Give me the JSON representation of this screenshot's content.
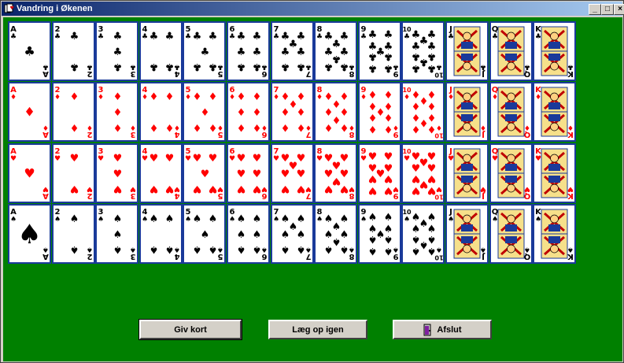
{
  "window": {
    "title": "Vandring i Økenen",
    "controls": {
      "minimize": "_",
      "maximize": "□",
      "close": "×"
    }
  },
  "colors": {
    "felt": "#008000",
    "titlebar": "#0a246a",
    "card_border": "#1a3a9a",
    "red": "#ff0000",
    "black": "#000000"
  },
  "board": {
    "rows": [
      {
        "suit": "clubs",
        "symbol": "♣",
        "color": "black",
        "ranks": [
          "A",
          "2",
          "3",
          "4",
          "5",
          "6",
          "7",
          "8",
          "9",
          "10",
          "J",
          "Q",
          "K"
        ]
      },
      {
        "suit": "diamonds",
        "symbol": "♦",
        "color": "red",
        "ranks": [
          "A",
          "2",
          "3",
          "4",
          "5",
          "6",
          "7",
          "8",
          "9",
          "10",
          "J",
          "Q",
          "K"
        ]
      },
      {
        "suit": "hearts",
        "symbol": "♥",
        "color": "red",
        "ranks": [
          "A",
          "2",
          "3",
          "4",
          "5",
          "6",
          "7",
          "8",
          "9",
          "10",
          "J",
          "Q",
          "K"
        ]
      },
      {
        "suit": "spades",
        "symbol": "♠",
        "color": "black",
        "ranks": [
          "A",
          "2",
          "3",
          "4",
          "5",
          "6",
          "7",
          "8",
          "9",
          "10",
          "J",
          "Q",
          "K"
        ]
      }
    ]
  },
  "buttons": {
    "deal": "Giv kort",
    "redeal": "Læg op igen",
    "exit": "Afslut"
  }
}
